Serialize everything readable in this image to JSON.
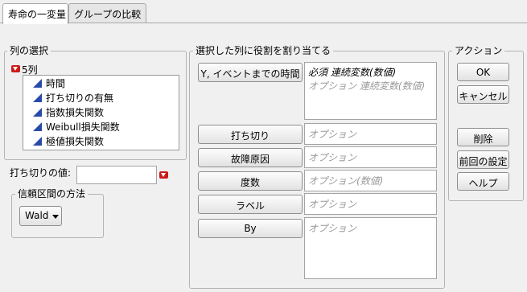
{
  "tabs": [
    "寿命の一変量",
    "グループの比較"
  ],
  "column_select": {
    "legend": "列の選択",
    "count_label": "5列",
    "columns": [
      "時間",
      "打ち切りの有無",
      "指数損失関数",
      "Weibull損失関数",
      "極値損失関数"
    ]
  },
  "censor_value": {
    "label": "打ち切りの値:",
    "value": ""
  },
  "confidence": {
    "legend": "信頼区間の方法",
    "selected": "Wald"
  },
  "roles": {
    "legend": "選択した列に役割を割り当てる",
    "items": [
      {
        "button": "Y, イベントまでの時間",
        "lines": [
          "必須 連続変数(数値)",
          "オプション 連続変数(数値)"
        ]
      },
      {
        "button": "打ち切り",
        "lines": [
          "オプション"
        ]
      },
      {
        "button": "故障原因",
        "lines": [
          "オプション"
        ]
      },
      {
        "button": "度数",
        "lines": [
          "オプション(数値)"
        ]
      },
      {
        "button": "ラベル",
        "lines": [
          "オプション"
        ]
      },
      {
        "button": "By",
        "lines": [
          "オプション"
        ]
      }
    ]
  },
  "actions": {
    "legend": "アクション",
    "ok": "OK",
    "cancel": "キャンセル",
    "remove": "削除",
    "recall": "前回の設定",
    "help": "ヘルプ"
  }
}
